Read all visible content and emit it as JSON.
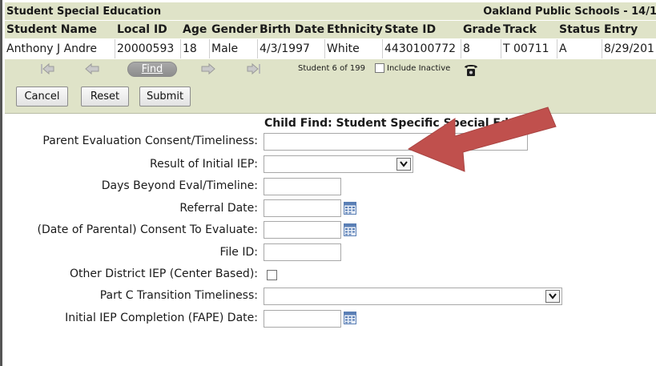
{
  "header": {
    "module_title": "Student Special Education",
    "district": "Oakland Public Schools - 14/1"
  },
  "student_table": {
    "columns": [
      "Student Name",
      "Local ID",
      "Age",
      "Gender",
      "Birth Date",
      "Ethnicity",
      "State ID",
      "Grade",
      "Track",
      "Status",
      "Entry"
    ],
    "row": [
      "Anthony J Andre",
      "20000593",
      "18",
      "Male",
      "4/3/1997",
      "White",
      "4430100772",
      "8",
      "T 00711",
      "A",
      "8/29/201"
    ]
  },
  "navigation": {
    "find_label": "Find",
    "counter": "Student 6 of 199",
    "include_inactive_label": "Include Inactive",
    "include_inactive_checked": false,
    "icons": [
      "first-record-icon",
      "previous-record-icon",
      "next-record-icon",
      "last-record-icon",
      "phone-icon"
    ]
  },
  "toolbar": {
    "cancel_label": "Cancel",
    "reset_label": "Reset",
    "submit_label": "Submit"
  },
  "form": {
    "section_title": "Child Find: Student Specific Special Ed Data",
    "fields": [
      {
        "label": "Parent Evaluation Consent/Timeliness:",
        "type": "text",
        "value": ""
      },
      {
        "label": "Result of Initial IEP:",
        "type": "select",
        "value": ""
      },
      {
        "label": "Days Beyond Eval/Timeline:",
        "type": "text",
        "value": ""
      },
      {
        "label": "Referral Date:",
        "type": "date",
        "value": ""
      },
      {
        "label": "(Date of Parental) Consent To Evaluate:",
        "type": "date",
        "value": ""
      },
      {
        "label": "File ID:",
        "type": "text",
        "value": ""
      },
      {
        "label": "Other District IEP (Center Based):",
        "type": "checkbox",
        "checked": false
      },
      {
        "label": "Part C Transition Timeliness:",
        "type": "select",
        "value": ""
      },
      {
        "label": "Initial IEP Completion (FAPE) Date:",
        "type": "date",
        "value": ""
      }
    ]
  },
  "colors": {
    "header_bg": "#dfe3c8",
    "annotation_arrow": "#c0504d",
    "calendar_icon": "#5a7fb5"
  }
}
